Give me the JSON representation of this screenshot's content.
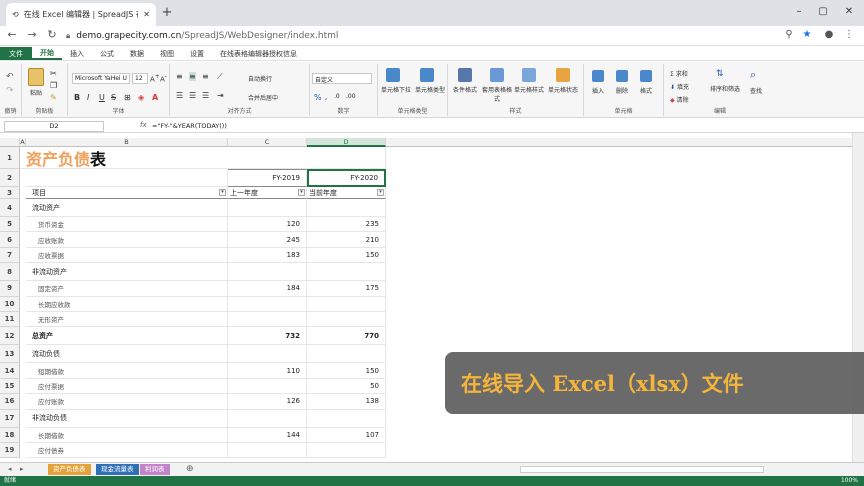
{
  "browser": {
    "tab_title": "在线 Excel 编辑器 | SpreadJS 在",
    "url_domain": "demo.grapecity.com.cn",
    "url_path": "/SpreadJS/WebDesigner/index.html"
  },
  "ribbon_tabs": [
    "文件",
    "开始",
    "插入",
    "公式",
    "数据",
    "视图",
    "设置",
    "在线表格编辑器授权信息"
  ],
  "ribbon": {
    "paste": "粘贴",
    "clipboard": "剪贴板",
    "cut": "剪切",
    "font_name": "Microsoft YaHei U",
    "font_size": "12",
    "font_group": "字体",
    "wrap": "自动换行",
    "merge": "合并后居中",
    "align_group": "对齐方式",
    "number_format": "自定义",
    "number_group": "数字",
    "cell_dropdown": "单元格下拉",
    "cell_type": "单元格类型",
    "cell_type_group": "单元格类型",
    "cond_format": "条件格式",
    "table_format": "套用表格格式",
    "cell_style": "单元格样式",
    "cell_state": "单元格状态",
    "style_group": "样式",
    "insert": "插入",
    "delete": "删除",
    "format": "格式",
    "cells_group": "单元格",
    "sum": "求和",
    "fill": "填充",
    "clear": "清除",
    "sort_filter": "排序和筛选",
    "find": "查找",
    "edit_group": "编辑",
    "cancel": "撤销",
    "italic_b": "B",
    "italic_i": "I",
    "italic_u": "U",
    "italic_s": "S",
    "fx": "fx"
  },
  "formula_bar": {
    "name_box": "D2",
    "formula": "=\"FY-\"&YEAR(TODAY())"
  },
  "grid": {
    "columns": [
      "A",
      "B",
      "C",
      "D"
    ],
    "title_orange": "资产负债",
    "title_black": "表",
    "header_row2": {
      "c": "FY-2019",
      "d": "FY-2020"
    },
    "header_row3": {
      "b": "项目",
      "c": "上一年度",
      "d": "当前年度"
    },
    "rows": [
      {
        "n": "4",
        "label": "流动资产",
        "c": "",
        "d": "",
        "kind": "sec"
      },
      {
        "n": "5",
        "label": "货币资金",
        "c": "120",
        "d": "235",
        "kind": "sub"
      },
      {
        "n": "6",
        "label": "应收账款",
        "c": "245",
        "d": "210",
        "kind": "sub"
      },
      {
        "n": "7",
        "label": "应收票据",
        "c": "183",
        "d": "150",
        "kind": "sub"
      },
      {
        "n": "8",
        "label": "非流动资产",
        "c": "",
        "d": "",
        "kind": "sec"
      },
      {
        "n": "9",
        "label": "固定资产",
        "c": "184",
        "d": "175",
        "kind": "sub"
      },
      {
        "n": "10",
        "label": "长期应收款",
        "c": "",
        "d": "",
        "kind": "sub"
      },
      {
        "n": "11",
        "label": "无形资产",
        "c": "",
        "d": "",
        "kind": "sub"
      },
      {
        "n": "12",
        "label": "总资产",
        "c": "732",
        "d": "770",
        "kind": "total"
      },
      {
        "n": "13",
        "label": "流动负债",
        "c": "",
        "d": "",
        "kind": "sec"
      },
      {
        "n": "14",
        "label": "短期借款",
        "c": "110",
        "d": "150",
        "kind": "sub"
      },
      {
        "n": "15",
        "label": "应付票据",
        "c": "",
        "d": "50",
        "kind": "sub"
      },
      {
        "n": "16",
        "label": "应付账款",
        "c": "126",
        "d": "138",
        "kind": "sub"
      },
      {
        "n": "17",
        "label": "非流动负债",
        "c": "",
        "d": "",
        "kind": "sec"
      },
      {
        "n": "18",
        "label": "长期借款",
        "c": "144",
        "d": "107",
        "kind": "sub"
      },
      {
        "n": "19",
        "label": "应付债券",
        "c": "",
        "d": "",
        "kind": "sub"
      }
    ]
  },
  "sheet_tabs": [
    {
      "label": "资产负债表",
      "color": "#e3a33a"
    },
    {
      "label": "现金流量表",
      "color": "#2f6fb5"
    },
    {
      "label": "利润表",
      "color": "#c383c9"
    }
  ],
  "status_text": "就绪",
  "zoom": "100%",
  "banner": "在线导入 Excel（xlsx）文件",
  "colors": {
    "accent": "#217346",
    "title_orange": "#f0a05a",
    "banner_text": "#f5b53a"
  }
}
